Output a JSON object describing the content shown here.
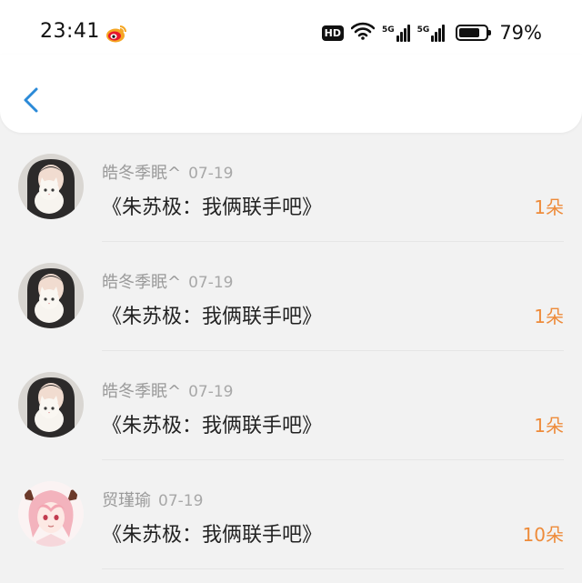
{
  "status_bar": {
    "time": "23:41",
    "hd_label": "HD",
    "network_1": "5G",
    "network_2": "5G",
    "battery_percent": 79,
    "battery_text": "79%",
    "app_icon": "weibo-icon"
  },
  "nav": {
    "back_icon": "chevron-left-icon",
    "accent_color": "#2b8ad8"
  },
  "items": [
    {
      "user": "皓冬季眠^",
      "date": "07-19",
      "title": "《朱苏极：我俩联手吧》",
      "count": "1朵",
      "avatar": "girl-with-white-cat"
    },
    {
      "user": "皓冬季眠^",
      "date": "07-19",
      "title": "《朱苏极：我俩联手吧》",
      "count": "1朵",
      "avatar": "girl-with-white-cat"
    },
    {
      "user": "皓冬季眠^",
      "date": "07-19",
      "title": "《朱苏极：我俩联手吧》",
      "count": "1朵",
      "avatar": "girl-with-white-cat"
    },
    {
      "user": "贸瑾瑜",
      "date": "07-19",
      "title": "《朱苏极：我俩联手吧》",
      "count": "10朵",
      "avatar": "anime-pink-hair"
    }
  ],
  "colors": {
    "count": "#ee8b3a",
    "username": "#9a9a9a",
    "title": "#222222",
    "background": "#f2f2f2"
  }
}
